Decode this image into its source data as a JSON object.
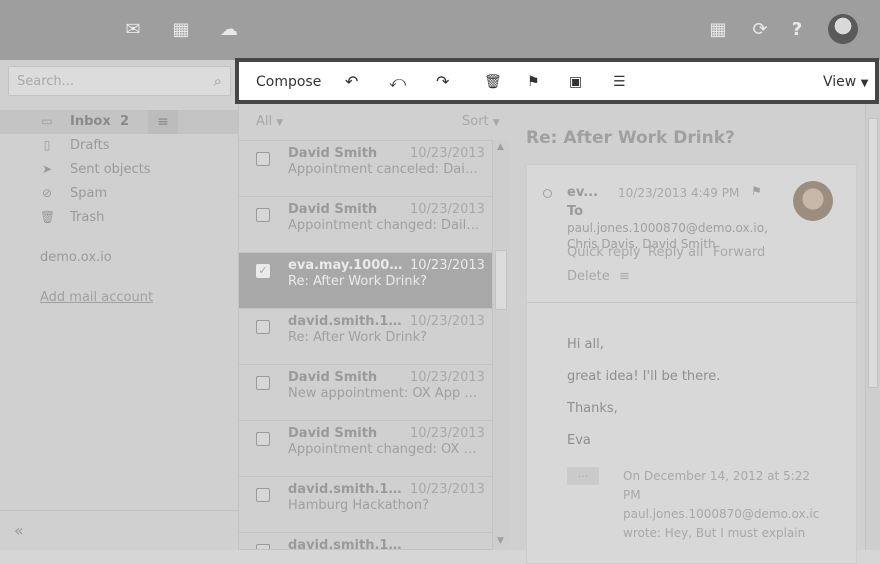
{
  "topbar": {
    "icons": [
      "mail-icon",
      "calendar-icon",
      "cloud-icon",
      "apps-grid-icon",
      "refresh-icon",
      "help-icon",
      "user-avatar"
    ]
  },
  "search": {
    "placeholder": "Search..."
  },
  "folders": [
    {
      "label": "Inbox",
      "count": "2"
    },
    {
      "label": "Drafts"
    },
    {
      "label": "Sent objects"
    },
    {
      "label": "Spam"
    },
    {
      "label": "Trash"
    }
  ],
  "account": "demo.ox.io",
  "add_account": "Add mail account",
  "collapse_label": "«",
  "toolbar": {
    "compose": "Compose",
    "view": "View"
  },
  "list": {
    "filter": "All",
    "sort": "Sort",
    "items": [
      {
        "from": "David Smith",
        "date": "10/23/2013",
        "subject": "Appointment canceled: Daily St..."
      },
      {
        "from": "David Smith",
        "date": "10/23/2013",
        "subject": "Appointment changed: Daily St..."
      },
      {
        "from": "eva.may.1000870...",
        "date": "10/23/2013",
        "subject": "Re: After Work Drink?"
      },
      {
        "from": "david.smith.1000...",
        "date": "10/23/2013",
        "subject": "Re: After Work Drink?"
      },
      {
        "from": "David Smith",
        "date": "10/23/2013",
        "subject": "New appointment: OX App Sui..."
      },
      {
        "from": "David Smith",
        "date": "10/23/2013",
        "subject": "Appointment changed: OX Ap..."
      },
      {
        "from": "david.smith.1000...",
        "date": "10/23/2013",
        "subject": "Hamburg Hackathon?"
      },
      {
        "from": "david.smith.1000...",
        "date": "",
        "subject": ""
      }
    ]
  },
  "detail": {
    "title": "Re: After Work Drink?",
    "sender": "ev...",
    "date": "10/23/2013 4:49 PM",
    "to_label": "To",
    "to": "paul.jones.1000870@demo.ox.io,",
    "cc": "Chris Davis,   David Smith",
    "actions": {
      "quick_reply": "Quick reply",
      "reply_all": "Reply all",
      "forward": "Forward",
      "delete": "Delete"
    },
    "body": [
      "Hi all,",
      "great idea! I'll be there.",
      "Thanks,",
      "Eva"
    ],
    "ellipsis": "...",
    "quote": "On December 14, 2012 at 5:22 PM paul.jones.1000870@demo.ox.ic wrote: Hey, But I must explain"
  }
}
